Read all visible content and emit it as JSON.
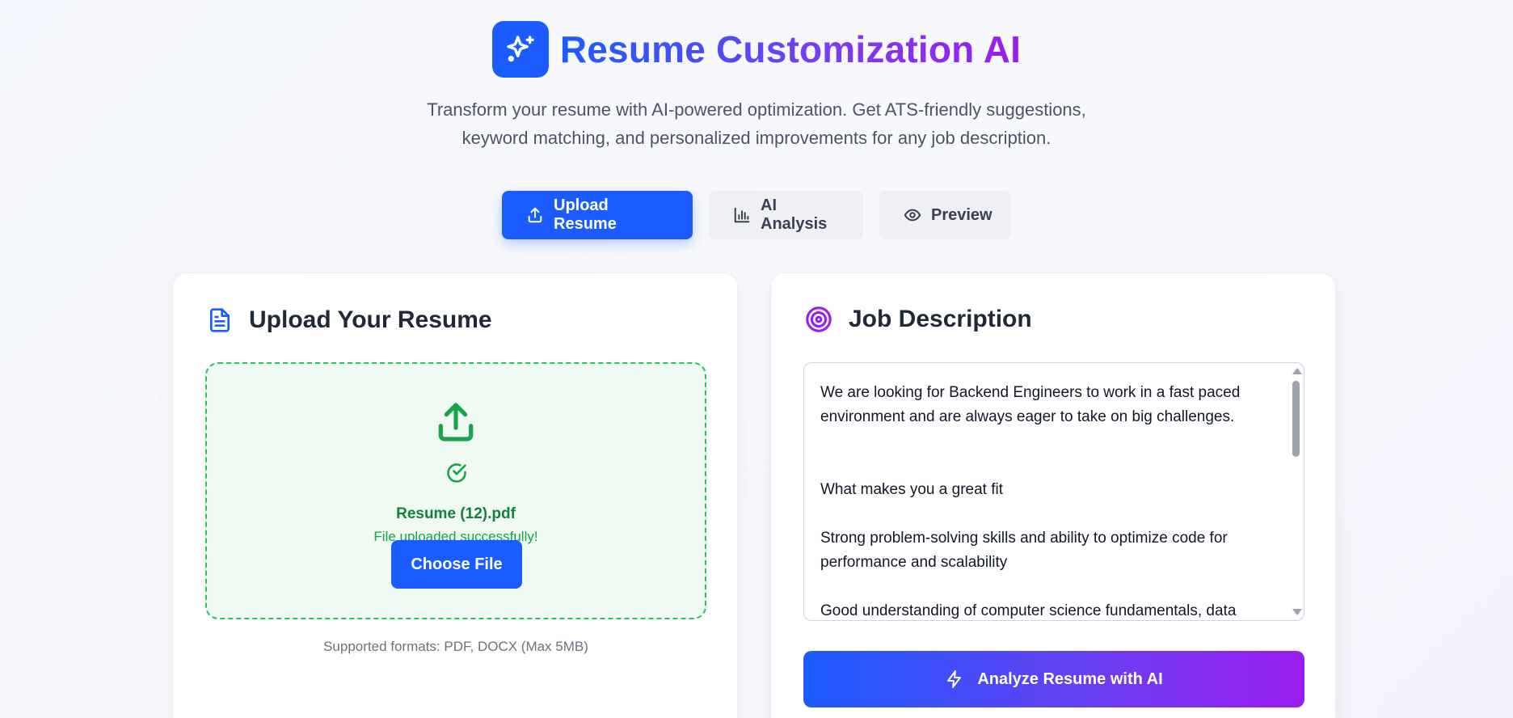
{
  "header": {
    "title": "Resume Customization AI",
    "subtitle_line1": "Transform your resume with AI-powered optimization. Get ATS-friendly suggestions,",
    "subtitle_line2": "keyword matching, and personalized improvements for any job description.",
    "logo_icon": "sparkles-icon"
  },
  "tabs": [
    {
      "label": "Upload Resume",
      "icon": "upload-icon",
      "active": true
    },
    {
      "label": "AI Analysis",
      "icon": "bar-chart-icon",
      "active": false
    },
    {
      "label": "Preview",
      "icon": "eye-icon",
      "active": false
    }
  ],
  "upload_card": {
    "title": "Upload Your Resume",
    "icon": "file-text-icon",
    "file_name": "Resume (12).pdf",
    "status": "File uploaded successfully!",
    "choose_label": "Choose File",
    "formats": "Supported formats: PDF, DOCX (Max 5MB)"
  },
  "job_card": {
    "title": "Job Description",
    "icon": "target-icon",
    "text": "We are looking for Backend Engineers to work in a fast paced\nenvironment and are always eager to take on big challenges.\n\n\nWhat makes you a great fit\n\nStrong problem-solving skills and ability to optimize code for\nperformance and scalability\n\nGood understanding of computer science fundamentals, data",
    "analyze_label": "Analyze Resume with AI",
    "analyze_icon": "zap-icon"
  },
  "colors": {
    "primary": "#1a5cff",
    "accent_purple": "#9a1cf2",
    "success": "#16a34a"
  }
}
